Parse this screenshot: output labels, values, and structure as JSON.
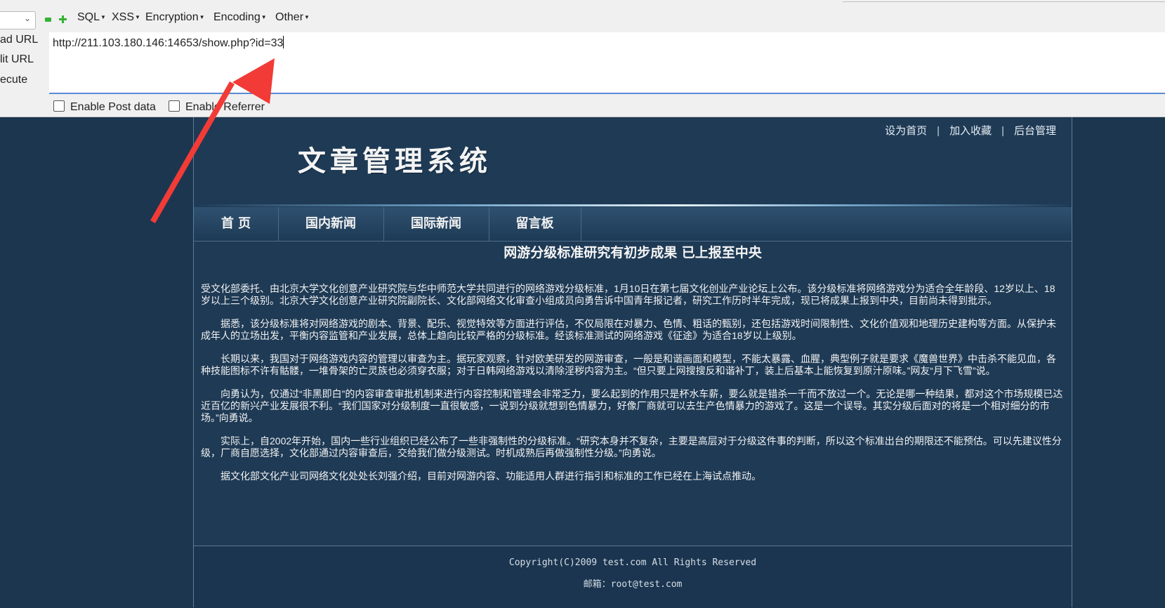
{
  "hackbar": {
    "select_value": "",
    "menus": [
      "SQL",
      "XSS",
      "Encryption",
      "Encoding",
      "Other"
    ],
    "side_labels": [
      "ad URL",
      "lit URL",
      "ecute"
    ],
    "url_value": "http://211.103.180.146:14653/show.php?id=33",
    "checkboxes": [
      "Enable Post data",
      "Enable Referrer"
    ]
  },
  "site": {
    "top_links": [
      "设为首页",
      "加入收藏",
      "后台管理"
    ],
    "logo_text": "文章管理系统",
    "nav": [
      "首 页",
      "国内新闻",
      "国际新闻",
      "留言板"
    ],
    "article_title": "网游分级标准研究有初步成果  已上报至中央",
    "paragraphs": [
      "受文化部委托、由北京大学文化创意产业研究院与华中师范大学共同进行的网络游戏分级标准，1月10日在第七届文化创业产业论坛上公布。该分级标准将网络游戏分为适合全年龄段、12岁以上、18岁以上三个级别。北京大学文化创意产业研究院副院长、文化部网络文化审查小组成员向勇告诉中国青年报记者，研究工作历时半年完成，现已将成果上报到中央，目前尚未得到批示。",
      "　　据悉，该分级标准将对网络游戏的剧本、背景、配乐、视觉特效等方面进行评估，不仅局限在对暴力、色情、粗话的甄别，还包括游戏时间限制性、文化价值观和地理历史建构等方面。从保护未成年人的立场出发，平衡内容监管和产业发展，总体上趋向比较严格的分级标准。经该标准测试的网络游戏《征途》为适合18岁以上级别。",
      "　　长期以来，我国对于网络游戏内容的管理以审查为主。据玩家观察，针对欧美研发的网游审查，一般是和谐画面和模型，不能太暴露、血腥，典型例子就是要求《魔兽世界》中击杀不能见血，各种技能图标不许有骷髅，一堆骨架的亡灵族也必须穿衣服；对于日韩网络游戏以清除淫秽内容为主。“但只要上网搜搜反和谐补丁，装上后基本上能恢复到原汁原味。”网友“月下飞雪”说。",
      "　　向勇认为，仅通过“非黑即白”的内容审查审批机制来进行内容控制和管理会非常乏力，要么起到的作用只是杯水车薪，要么就是错杀一千而不放过一个。无论是哪一种结果，都对这个市场规模已达近百亿的新兴产业发展很不利。“我们国家对分级制度一直很敏感，一说到分级就想到色情暴力，好像厂商就可以去生产色情暴力的游戏了。这是一个误导。其实分级后面对的将是一个相对细分的市场。”向勇说。",
      "　　实际上，自2002年开始，国内一些行业组织已经公布了一些非强制性的分级标准。“研究本身并不复杂，主要是高层对于分级这件事的判断，所以这个标准出台的期限还不能预估。可以先建议性分级，厂商自愿选择，文化部通过内容审查后，交给我们做分级测试。时机成熟后再做强制性分级。”向勇说。",
      "　　据文化部文化产业司网络文化处处长刘强介绍，目前对网游内容、功能适用人群进行指引和标准的工作已经在上海试点推动。"
    ],
    "footer_copyright": "Copyright(C)2009 test.com All Rights Reserved",
    "footer_email": "邮箱：root@test.com"
  },
  "annotation": {
    "arrow_color": "#f23b36"
  }
}
